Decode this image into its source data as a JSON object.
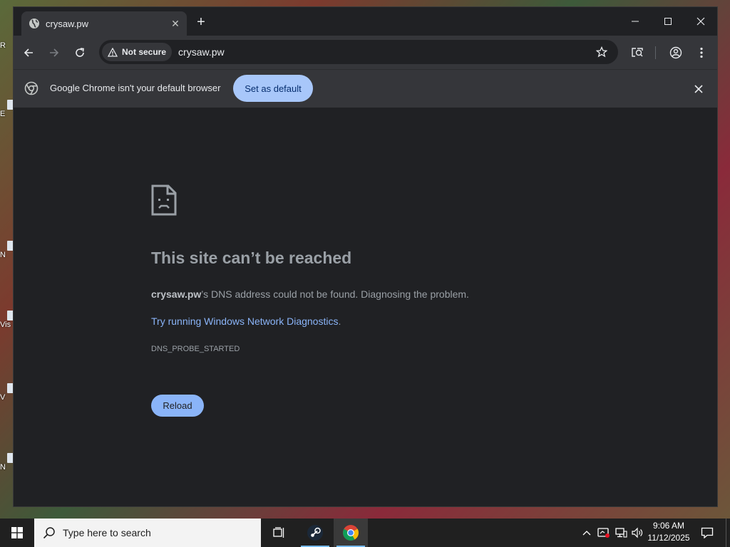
{
  "tab": {
    "title": "crysaw.pw"
  },
  "omnibox": {
    "security_label": "Not secure",
    "url": "crysaw.pw"
  },
  "infobar": {
    "message": "Google Chrome isn't your default browser",
    "action_label": "Set as default"
  },
  "error_page": {
    "title": "This site can’t be reached",
    "host": "crysaw.pw",
    "description_rest": "’s DNS address could not be found. Diagnosing the problem.",
    "link_text": "Try running Windows Network Diagnostics",
    "link_suffix": ".",
    "error_code": "DNS_PROBE_STARTED",
    "reload_label": "Reload"
  },
  "taskbar": {
    "search_placeholder": "Type here to search",
    "time": "9:06 AM",
    "date": "11/12/2025"
  },
  "desktop_fragments": [
    "R",
    "E",
    "N",
    "Vis",
    "V",
    "N"
  ],
  "colors": {
    "accent_blue": "#8ab4f8",
    "infobar_button": "#a8c7fa",
    "background_dark": "#202124",
    "toolbar": "#35363a"
  }
}
